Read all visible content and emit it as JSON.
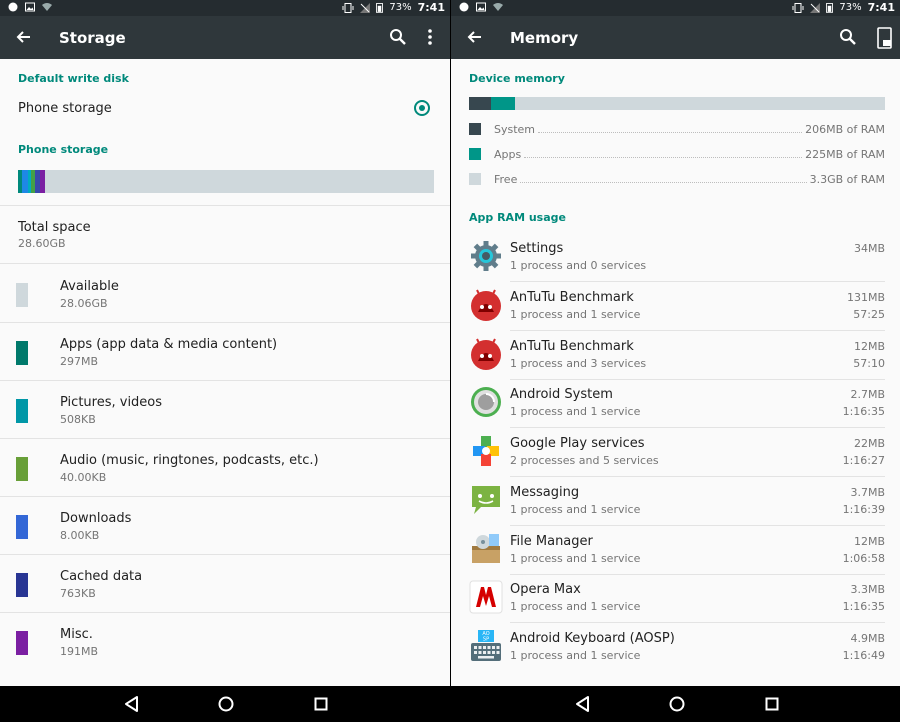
{
  "statusbar": {
    "battery": "73%",
    "time": "7:41"
  },
  "storage_screen": {
    "title": "Storage",
    "default_write_disk_header": "Default write disk",
    "default_write_disk_option": "Phone storage",
    "phone_storage_header": "Phone storage",
    "bar_colors": [
      "#00897b",
      "#1e88e5",
      "#00acc1",
      "#43a047",
      "#3949ab",
      "#7b1fa2"
    ],
    "total_space": {
      "label": "Total space",
      "value": "28.60GB"
    },
    "categories": [
      {
        "name": "Available",
        "size": "28.06GB",
        "color": "#cfd8dc"
      },
      {
        "name": "Apps (app data & media content)",
        "size": "297MB",
        "color": "#00796b"
      },
      {
        "name": "Pictures, videos",
        "size": "508KB",
        "color": "#0097a7"
      },
      {
        "name": "Audio (music, ringtones, podcasts, etc.)",
        "size": "40.00KB",
        "color": "#689f38"
      },
      {
        "name": "Downloads",
        "size": "8.00KB",
        "color": "#3367d6"
      },
      {
        "name": "Cached data",
        "size": "763KB",
        "color": "#283593"
      },
      {
        "name": "Misc.",
        "size": "191MB",
        "color": "#7b1fa2"
      }
    ]
  },
  "memory_screen": {
    "title": "Memory",
    "device_memory_header": "Device memory",
    "memory_bar": {
      "system_fraction": 0.052,
      "apps_fraction": 0.058
    },
    "legend": [
      {
        "label": "System",
        "value": "206MB of RAM",
        "color": "#37474f"
      },
      {
        "label": "Apps",
        "value": "225MB of RAM",
        "color": "#009688"
      },
      {
        "label": "Free",
        "value": "3.3GB of RAM",
        "color": "#cfd8dc"
      }
    ],
    "app_ram_header": "App RAM usage",
    "apps": [
      {
        "name": "Settings",
        "info": "1 process and 0 services",
        "size": "34MB",
        "time": "",
        "icon": "settings-gear-icon"
      },
      {
        "name": "AnTuTu Benchmark",
        "info": "1 process and 1 service",
        "size": "131MB",
        "time": "57:25",
        "icon": "antutu-icon"
      },
      {
        "name": "AnTuTu Benchmark",
        "info": "1 process and 3 services",
        "size": "12MB",
        "time": "57:10",
        "icon": "antutu-icon"
      },
      {
        "name": "Android System",
        "info": "1 process and 1 service",
        "size": "2.7MB",
        "time": "1:16:35",
        "icon": "android-system-icon"
      },
      {
        "name": "Google Play services",
        "info": "2 processes and 5 services",
        "size": "22MB",
        "time": "1:16:27",
        "icon": "google-play-services-icon"
      },
      {
        "name": "Messaging",
        "info": "1 process and 1 service",
        "size": "3.7MB",
        "time": "1:16:39",
        "icon": "messaging-icon"
      },
      {
        "name": "File Manager",
        "info": "1 process and 1 service",
        "size": "12MB",
        "time": "1:06:58",
        "icon": "file-manager-icon"
      },
      {
        "name": "Opera Max",
        "info": "1 process and 1 service",
        "size": "3.3MB",
        "time": "1:16:35",
        "icon": "opera-max-icon"
      },
      {
        "name": "Android Keyboard (AOSP)",
        "info": "1 process and 1 service",
        "size": "4.9MB",
        "time": "1:16:49",
        "icon": "keyboard-icon"
      }
    ]
  }
}
